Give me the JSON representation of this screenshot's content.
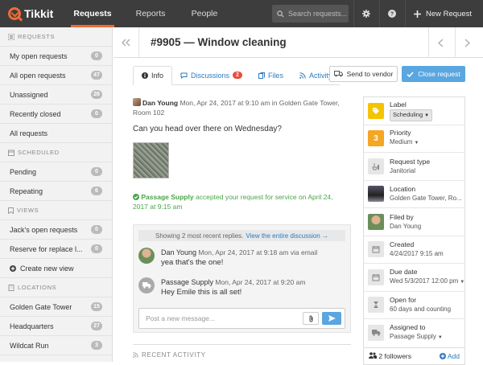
{
  "app": {
    "name": "Tikkit"
  },
  "topnav": {
    "items": [
      {
        "label": "Requests"
      },
      {
        "label": "Reports"
      },
      {
        "label": "People"
      }
    ],
    "search_placeholder": "Search requests...",
    "new_request": "New Request"
  },
  "sidebar": {
    "sections": [
      {
        "title": "REQUESTS",
        "items": [
          {
            "label": "My open requests",
            "count": "0"
          },
          {
            "label": "All open requests",
            "count": "47"
          },
          {
            "label": "Unassigned",
            "count": "26"
          },
          {
            "label": "Recently closed",
            "count": "0"
          },
          {
            "label": "All requests",
            "count": ""
          }
        ]
      },
      {
        "title": "SCHEDULED",
        "items": [
          {
            "label": "Pending",
            "count": "0"
          },
          {
            "label": "Repeating",
            "count": "6"
          }
        ]
      },
      {
        "title": "VIEWS",
        "items": [
          {
            "label": "Jack's open requests",
            "count": "0"
          },
          {
            "label": "Reserve for replace l...",
            "count": "0"
          },
          {
            "label": "Create new view",
            "count": ""
          }
        ]
      },
      {
        "title": "LOCATIONS",
        "items": [
          {
            "label": "Golden Gate Tower",
            "count": "15"
          },
          {
            "label": "Headquarters",
            "count": "27"
          },
          {
            "label": "Wildcat Run",
            "count": "3"
          }
        ]
      }
    ]
  },
  "request": {
    "title": "#9905 — Window cleaning",
    "tabs": {
      "info": "Info",
      "discussions": "Discussions",
      "discussions_count": "2",
      "files": "Files",
      "activity": "Activity"
    },
    "send_to_vendor": "Send to vendor",
    "close_request": "Close request",
    "author": "Dan Young",
    "posted_meta": "Mon, Apr 24, 2017 at 9:10 am in Golden Gate Tower, Room 102",
    "body": "Can you head over there on Wednesday?",
    "accepted_vendor": "Passage Supply",
    "accepted_text": "accepted your request for service on April 24, 2017 at 9:15 am",
    "thread": {
      "showing": "Showing 2 most recent replies.",
      "view_all": "View the entire discussion →",
      "replies": [
        {
          "author": "Dan Young",
          "meta": "Mon, Apr 24, 2017 at 9:18 am via email",
          "text": "yea that's the one!"
        },
        {
          "author": "Passage Supply",
          "meta": "Mon, Apr 24, 2017 at 9:20 am",
          "text": "Hey Emile this is all set!"
        }
      ],
      "compose_placeholder": "Post a new message..."
    },
    "recent_activity": "RECENT ACTIVITY"
  },
  "props": [
    {
      "label": "Label",
      "value": "Scheduling",
      "icon": "tag-icon"
    },
    {
      "label": "Priority",
      "value": "Medium",
      "badge": "3",
      "icon": "priority-icon"
    },
    {
      "label": "Request type",
      "value": "Janitorial",
      "icon": "janitorial-icon"
    },
    {
      "label": "Location",
      "value": "Golden Gate Tower, Ro...",
      "icon": "location-photo"
    },
    {
      "label": "Filed by",
      "value": "Dan Young",
      "icon": "avatar"
    },
    {
      "label": "Created",
      "value": "4/24/2017 9:15 am",
      "icon": "calendar-icon"
    },
    {
      "label": "Due date",
      "value": "Wed 5/3/2017 12:00 pm",
      "icon": "calendar-icon"
    },
    {
      "label": "Open for",
      "value": "60 days and counting",
      "icon": "hourglass-icon"
    },
    {
      "label": "Assigned to",
      "value": "Passage Supply",
      "icon": "truck-icon"
    }
  ],
  "followers": {
    "label": "2 followers",
    "add": "Add"
  },
  "colors": {
    "accent": "#ef6b35",
    "primary": "#5aa6e0",
    "label_yellow": "#f5c400",
    "priority_orange": "#f5a623",
    "success": "#4aa64a"
  }
}
